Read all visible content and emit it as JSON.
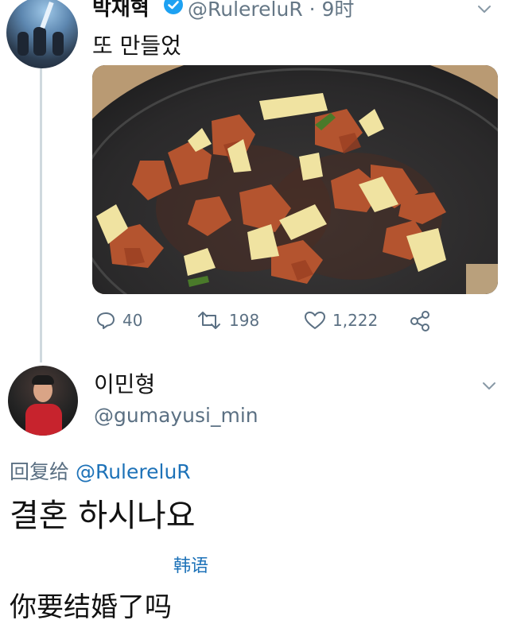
{
  "tweet": {
    "author_name": "박재혁",
    "handle_time": "@RulereluR · 9时",
    "text": "또 만들었",
    "replies": "40",
    "retweets": "198",
    "likes": "1,222"
  },
  "reply": {
    "author_name": "이민형",
    "handle": "@gumayusi_min",
    "reply_prefix": "回复给",
    "reply_to_handle": "@RulereluR",
    "text": "결혼 하시나요",
    "translate_label": "韩语",
    "translation": "你要结婚了吗"
  },
  "colors": {
    "verified": "#1da1f2",
    "link": "#1d72b8",
    "secondary_text": "#5b7083",
    "thread_line": "#cfd9de"
  },
  "icons": [
    "verified-badge-icon",
    "chevron-down-icon",
    "reply-icon",
    "retweet-icon",
    "like-icon",
    "share-icon"
  ]
}
